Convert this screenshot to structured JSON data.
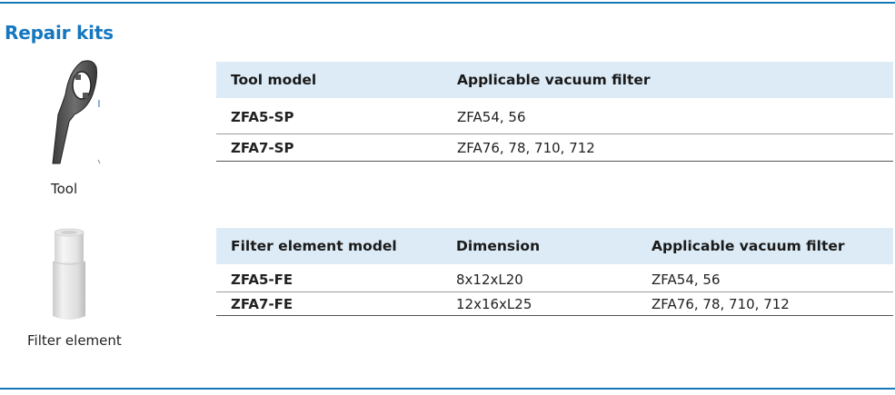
{
  "section": {
    "title": "Repair kits"
  },
  "tool": {
    "caption": "Tool",
    "table": {
      "headers": [
        "Tool model",
        "Applicable vacuum filter"
      ],
      "rows": [
        [
          "ZFA5-SP",
          "ZFA54, 56"
        ],
        [
          "ZFA7-SP",
          "ZFA76, 78, 710, 712"
        ]
      ]
    }
  },
  "filter_element": {
    "caption": "Filter element",
    "table": {
      "headers": [
        "Filter element model",
        "Dimension",
        "Applicable vacuum filter"
      ],
      "rows": [
        [
          "ZFA5-FE",
          "8x12xL20",
          "ZFA54, 56"
        ],
        [
          "ZFA7-FE",
          "12x16xL25",
          "ZFA76, 78, 710, 712"
        ]
      ]
    }
  },
  "colors": {
    "accent": "#1677bf",
    "header_bg": "#dcebf6",
    "rule": "#1877b8"
  }
}
